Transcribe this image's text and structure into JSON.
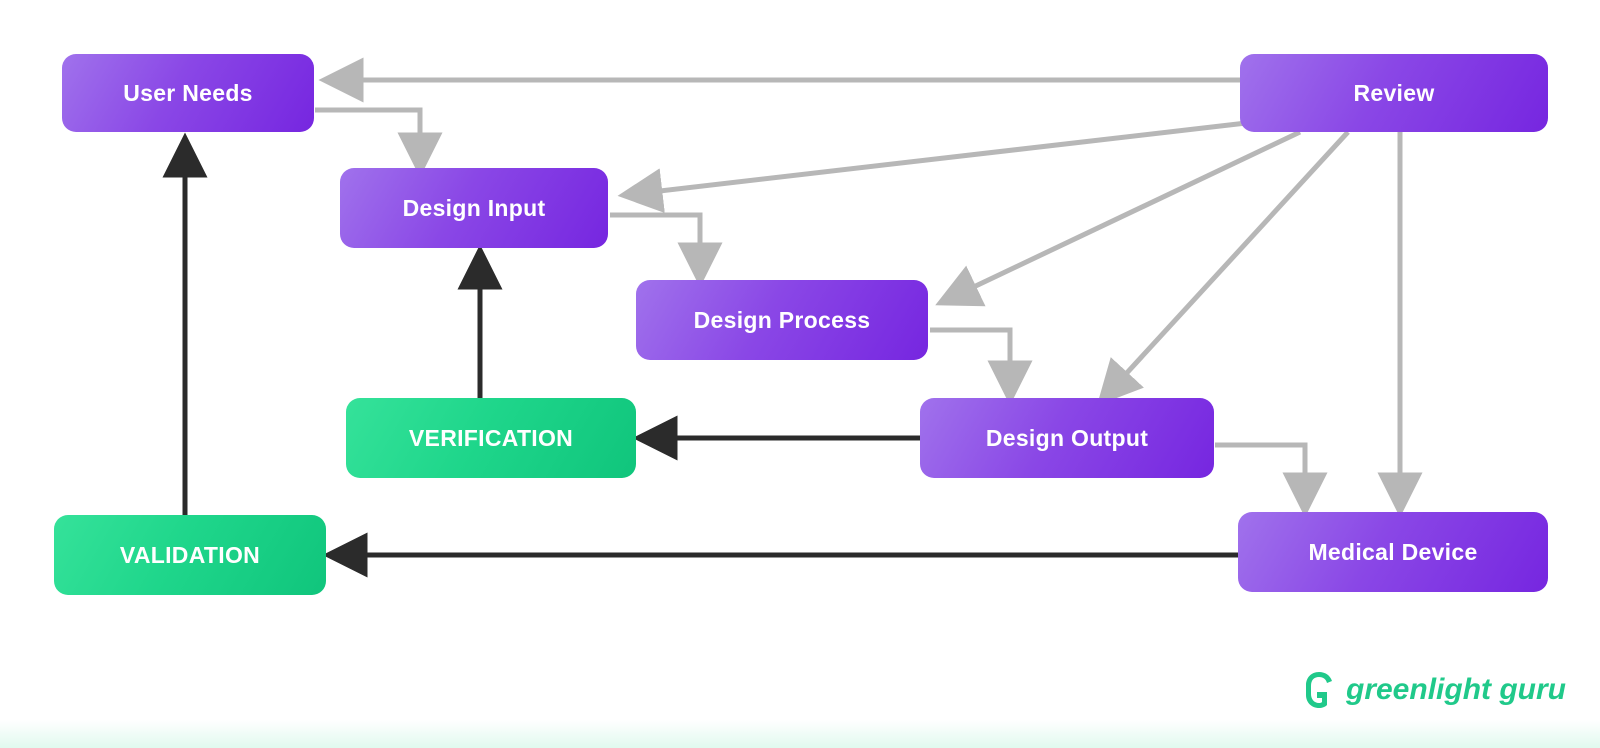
{
  "nodes": {
    "user_needs": {
      "label": "User Needs"
    },
    "design_input": {
      "label": "Design Input"
    },
    "design_process": {
      "label": "Design Process"
    },
    "design_output": {
      "label": "Design Output"
    },
    "medical_device": {
      "label": "Medical Device"
    },
    "review": {
      "label": "Review"
    },
    "verification": {
      "label": "VERIFICATION"
    },
    "validation": {
      "label": "VALIDATION"
    }
  },
  "branding": {
    "company": "greenlight guru"
  },
  "edges": {
    "grey": [
      {
        "from": "user_needs",
        "to": "design_input",
        "kind": "elbow"
      },
      {
        "from": "design_input",
        "to": "design_process",
        "kind": "elbow"
      },
      {
        "from": "design_process",
        "to": "design_output",
        "kind": "elbow"
      },
      {
        "from": "design_output",
        "to": "medical_device",
        "kind": "elbow"
      },
      {
        "from": "review",
        "to": "user_needs",
        "kind": "straight"
      },
      {
        "from": "review",
        "to": "design_input",
        "kind": "diag"
      },
      {
        "from": "review",
        "to": "design_process",
        "kind": "diag"
      },
      {
        "from": "review",
        "to": "design_output",
        "kind": "diag"
      },
      {
        "from": "review",
        "to": "medical_device",
        "kind": "straight_down"
      }
    ],
    "black": [
      {
        "from": "design_output",
        "to": "verification"
      },
      {
        "from": "verification",
        "to": "design_input"
      },
      {
        "from": "medical_device",
        "to": "validation"
      },
      {
        "from": "validation",
        "to": "user_needs"
      }
    ]
  },
  "colors": {
    "purple_from": "#a072ec",
    "purple_to": "#7626e0",
    "green_from": "#35e29a",
    "green_to": "#10c57c",
    "arrow_grey": "#b7b7b7",
    "arrow_black": "#2b2b2b"
  }
}
